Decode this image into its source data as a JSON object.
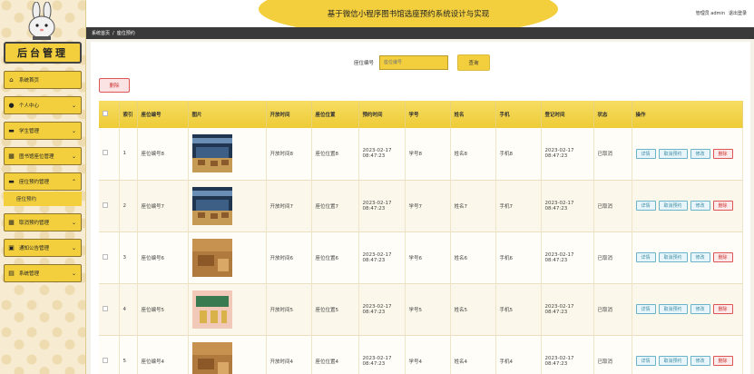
{
  "sidebar": {
    "title": "后台管理",
    "items": [
      {
        "label": "系统首页",
        "icon": "home-icon"
      },
      {
        "label": "个人中心",
        "icon": "user-icon"
      },
      {
        "label": "学生管理",
        "icon": "folder-icon"
      },
      {
        "label": "图书馆座位管理",
        "icon": "grid-icon"
      },
      {
        "label": "座位预约管理",
        "icon": "folder-icon"
      },
      {
        "label": "取消预约管理",
        "icon": "grid-icon"
      },
      {
        "label": "通知公告管理",
        "icon": "box-icon"
      },
      {
        "label": "系统管理",
        "icon": "chat-icon"
      }
    ],
    "sub_item": "座位预约"
  },
  "header": {
    "title": "基于微信小程序图书馆选座预约系统设计与实现",
    "admin_label": "管理员 admin",
    "logout_label": "退出登录"
  },
  "breadcrumb": {
    "home": "系统首页",
    "separator": "/",
    "current": "座位预约"
  },
  "search": {
    "label": "座位编号",
    "placeholder": "座位编号",
    "button": "查询"
  },
  "delete_button": "删除",
  "table": {
    "headers": [
      "索引",
      "座位编号",
      "图片",
      "开放时间",
      "座位位置",
      "预约时间",
      "学号",
      "姓名",
      "手机",
      "登记时间",
      "状态",
      "操作"
    ],
    "actions": {
      "detail": "详情",
      "cancel": "取消预约",
      "edit": "修改",
      "delete": "删除"
    },
    "rows": [
      {
        "index": "1",
        "seat_no": "座位编号8",
        "open_time": "开放时间8",
        "location": "座位位置8",
        "reserve_time": "2023-02-17 08:47:23",
        "student_no": "学号8",
        "name": "姓名8",
        "phone": "手机8",
        "reg_time": "2023-02-17 08:47:23",
        "status": "已取消",
        "thumb": "library"
      },
      {
        "index": "2",
        "seat_no": "座位编号7",
        "open_time": "开放时间7",
        "location": "座位位置7",
        "reserve_time": "2023-02-17 08:47:23",
        "student_no": "学号7",
        "name": "姓名7",
        "phone": "手机7",
        "reg_time": "2023-02-17 08:47:23",
        "status": "已取消",
        "thumb": "library"
      },
      {
        "index": "3",
        "seat_no": "座位编号6",
        "open_time": "开放时间6",
        "location": "座位位置6",
        "reserve_time": "2023-02-17 08:47:23",
        "student_no": "学号6",
        "name": "姓名6",
        "phone": "手机6",
        "reg_time": "2023-02-17 08:47:23",
        "status": "已取消",
        "thumb": "wood"
      },
      {
        "index": "4",
        "seat_no": "座位编号5",
        "open_time": "开放时间5",
        "location": "座位位置5",
        "reserve_time": "2023-02-17 08:47:23",
        "student_no": "学号5",
        "name": "姓名5",
        "phone": "手机5",
        "reg_time": "2023-02-17 08:47:23",
        "status": "已取消",
        "thumb": "pink"
      },
      {
        "index": "5",
        "seat_no": "座位编号4",
        "open_time": "开放时间4",
        "location": "座位位置4",
        "reserve_time": "2023-02-17 08:47:23",
        "student_no": "学号4",
        "name": "姓名4",
        "phone": "手机4",
        "reg_time": "2023-02-17 08:47:23",
        "status": "已取消",
        "thumb": "wood"
      }
    ]
  },
  "colors": {
    "accent": "#f3cf3e",
    "dark": "#3a3a3a",
    "danger": "#cc3333",
    "info": "#3a8aa3"
  }
}
